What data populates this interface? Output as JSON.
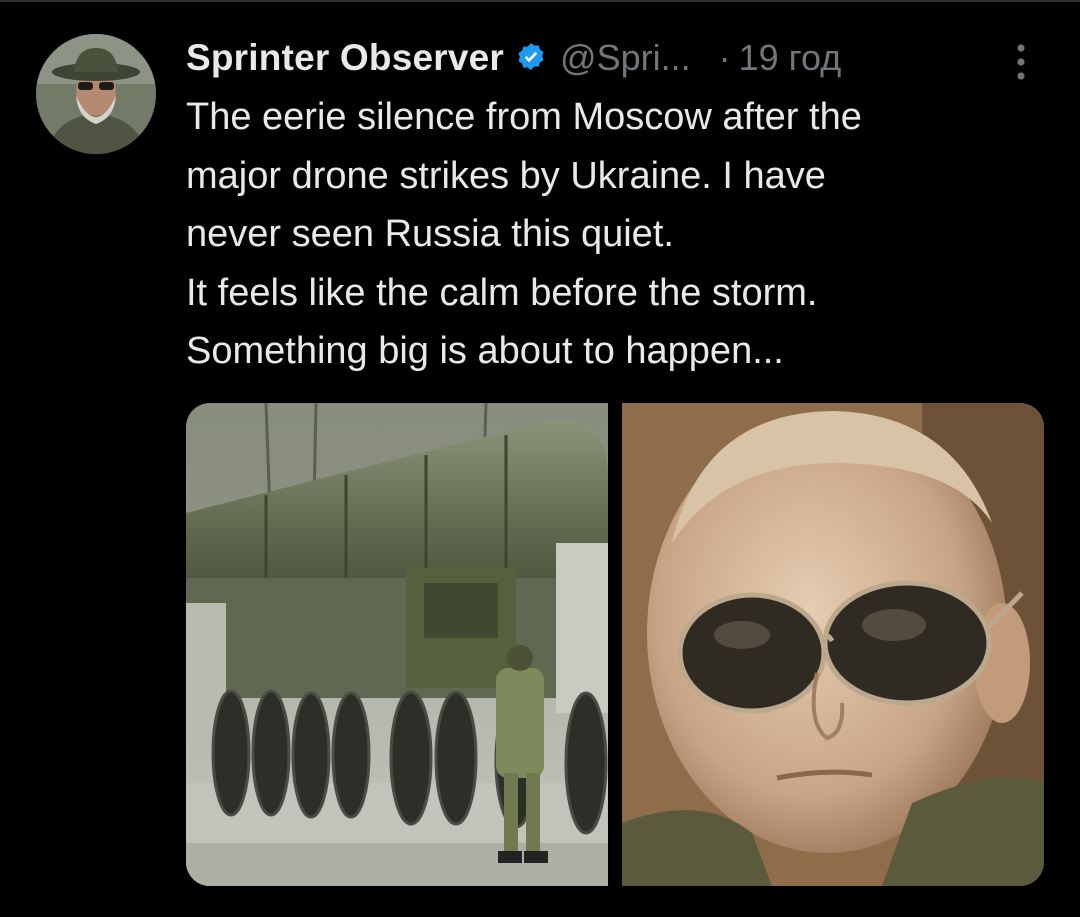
{
  "tweet": {
    "author_name": "Sprinter Observer",
    "verified_icon": "verified-badge-icon",
    "handle": "@Spri...",
    "separator": "·",
    "time": "19 год",
    "more_icon": "more-vertical-icon",
    "text_lines": [
      "The eerie silence from Moscow after the",
      "major drone strikes by Ukraine. I have",
      "never seen Russia this quiet.",
      "It feels like the calm before the storm.",
      "Something big is about to happen..."
    ],
    "media": [
      {
        "kind": "photo",
        "subject": "missile-launcher-truck-photo"
      },
      {
        "kind": "photo",
        "subject": "man-in-aviator-sunglasses-photo"
      }
    ]
  },
  "colors": {
    "background": "#000000",
    "text_primary": "#e7e9ea",
    "text_secondary": "#71767b",
    "verified_blue": "#1d9bf0"
  }
}
